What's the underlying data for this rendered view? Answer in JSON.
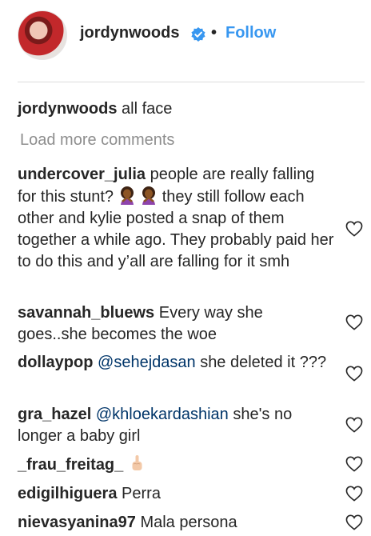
{
  "post": {
    "author": "jordynwoods",
    "follow_label": "Follow",
    "separator": "•",
    "verified_icon": "verified-badge-icon"
  },
  "caption": {
    "username": "jordynwoods",
    "text": "all face"
  },
  "load_more_label": "Load more comments",
  "comments": [
    {
      "username": "undercover_julia",
      "text_before": "people are really falling for this stunt?",
      "emoji": [
        "woman-gesturing-no-emoji",
        "woman-gesturing-no-emoji"
      ],
      "text_after": "they still follow each other and kylie posted a snap of them together a while ago. They probably paid her to do this and y’all are falling for it smh"
    },
    {
      "username": "savannah_bluews",
      "text": "Every way she goes..she becomes the woe"
    },
    {
      "username": "dollaypop",
      "mention": "@sehejdasan",
      "text": "she deleted it ???"
    },
    {
      "username": "gra_hazel",
      "mention": "@khloekardashian",
      "text": "she's no longer a baby girl"
    },
    {
      "username": "_frau_freitag_",
      "emoji": "middle-finger-emoji"
    },
    {
      "username": "edigilhiguera",
      "text": "Perra"
    },
    {
      "username": "nievasyanina97",
      "text": "Mala persona"
    }
  ],
  "icons": {
    "like": "heart-outline-icon"
  },
  "colors": {
    "link": "#3897f0",
    "text": "#262626",
    "muted": "#8e8e8e",
    "mention": "#003569"
  }
}
